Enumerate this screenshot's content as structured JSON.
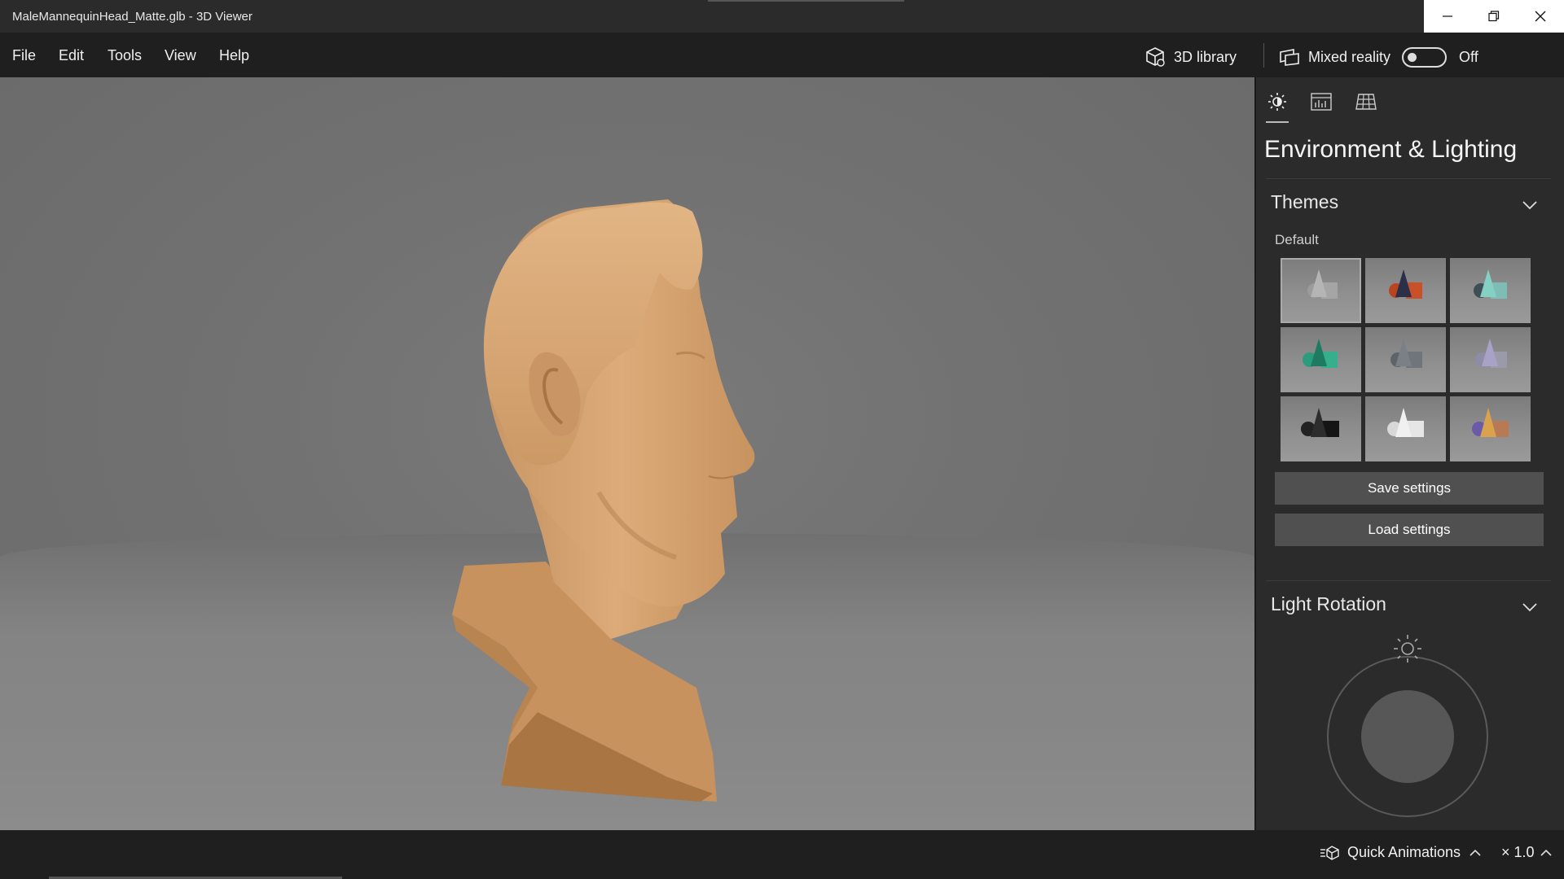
{
  "window": {
    "title": "MaleMannequinHead_Matte.glb - 3D Viewer"
  },
  "menu": {
    "items": [
      "File",
      "Edit",
      "Tools",
      "View",
      "Help"
    ]
  },
  "toolbar": {
    "library_label": "3D library",
    "mixed_reality_label": "Mixed reality",
    "mixed_reality_state": "Off"
  },
  "panel": {
    "title": "Environment & Lighting",
    "themes_heading": "Themes",
    "theme_label": "Default",
    "save_label": "Save settings",
    "load_label": "Load settings",
    "light_rotation_heading": "Light Rotation"
  },
  "status": {
    "quick_animations_label": "Quick Animations",
    "speed_label": "× 1.0"
  },
  "colors": {
    "accent_toggle": "#dddddd",
    "panel_bg": "#2b2b2b",
    "button_bg": "#505050",
    "model_skin": "#d9a775"
  },
  "icons": [
    "minimize-icon",
    "restore-icon",
    "close-icon",
    "cube-library-icon",
    "mixed-reality-icon",
    "sun-icon",
    "stats-icon",
    "grid-icon",
    "chevron-down-icon",
    "quick-animations-icon",
    "chevron-up-icon"
  ]
}
